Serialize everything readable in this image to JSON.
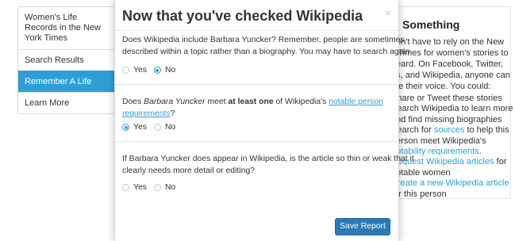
{
  "sidebar": {
    "items": [
      {
        "label": "Women's Life Records in the New York Times"
      },
      {
        "label": "Search Results"
      },
      {
        "label": "Remember A Life"
      },
      {
        "label": "Learn More"
      }
    ]
  },
  "right_panel": {
    "title": "Something",
    "intro_lines": [
      "don't have to rely on the New",
      "k Times for women's stories to",
      "heard. On Facebook, Twitter,",
      "gs, and Wikipedia, anyone can",
      "ate their voice. You could:"
    ],
    "list": {
      "share": "Share or Tweet these stories",
      "search_1": "Search Wikipedia to learn more",
      "search_2": "and find missing biographies",
      "sources_pre": "Search for ",
      "sources_link": "sources",
      "sources_post": " to help this",
      "sources_2": "person meet Wikipedia's",
      "notability_link": "notability requirements",
      "notability_post": ".",
      "request_link": "Request Wikipedia articles",
      "request_post": " for",
      "request_2": "notable women",
      "create_link": "Create a new Wikipedia article",
      "create_2": "for this person"
    }
  },
  "modal": {
    "title": "Now that you've checked Wikipedia",
    "close": "×",
    "questions": [
      {
        "line1": "Does Wikipedia include Barbara Yuncker? Remember, people are sometimes",
        "line2": "described within a topic rather than a biography. You may have to search again.",
        "options": [
          "Yes",
          "No"
        ],
        "selected": "No"
      },
      {
        "pre": "Does ",
        "name": "Barbara Yuncker",
        "mid": " meet ",
        "strong": "at least one",
        "post": " of Wikipedia's ",
        "link": "notable person",
        "link2": "requirements",
        "end": "?",
        "options": [
          "Yes",
          "No"
        ],
        "selected": "Yes"
      },
      {
        "line1": "If Barbara Yuncker does appear in Wikipedia, is the article so thin or weak that it",
        "line2": "clearly needs more detail or editing?",
        "options": [
          "Yes",
          "No"
        ],
        "selected": ""
      }
    ],
    "save_label": "Save Report"
  },
  "colors": {
    "accent": "#2e9fd6",
    "button": "#2a7ab8",
    "active_nav": "#2e9fd6"
  }
}
